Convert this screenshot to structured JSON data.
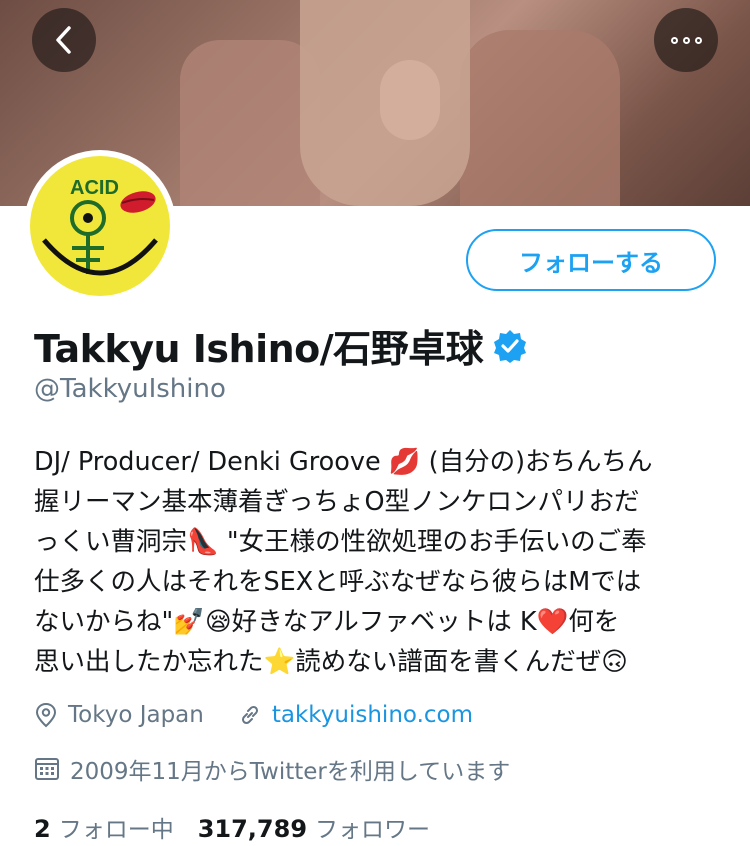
{
  "header": {
    "back_icon": "chevron-left-icon",
    "more_icon": "more-dots-icon"
  },
  "avatar": {
    "text": "ACID",
    "background": "#f1e73a"
  },
  "follow_button": {
    "label": "フォローする"
  },
  "profile": {
    "display_name": "Takkyu Ishino/石野卓球",
    "verified_icon": "verified-badge-icon",
    "handle": "@TakkyuIshino"
  },
  "bio": {
    "lines": [
      "DJ/ Producer/ Denki Groove 💋 (自分の)おちんちん",
      "握リーマン基本薄着ぎっちょO型ノンケロンパリおだ",
      "っくい曹洞宗👠 \"女王様の性欲処理のお手伝いのご奉",
      "仕多くの人はそれをSEXと呼ぶなぜなら彼らはMでは",
      "ないからね\"💅😪好きなアルファベットは K❤️何を",
      "思い出したか忘れた⭐読めない譜面を書くんだぜ🙃"
    ]
  },
  "meta": {
    "location": "Tokyo Japan",
    "website": "takkyuishino.com",
    "joined": "2009年11月からTwitterを利用しています"
  },
  "stats": {
    "following_count": "2",
    "following_label": "フォロー中",
    "followers_count": "317,789",
    "followers_label": "フォロワー"
  },
  "colors": {
    "accent": "#1da1f2",
    "link": "#1b95e0",
    "secondary_text": "#657786"
  }
}
